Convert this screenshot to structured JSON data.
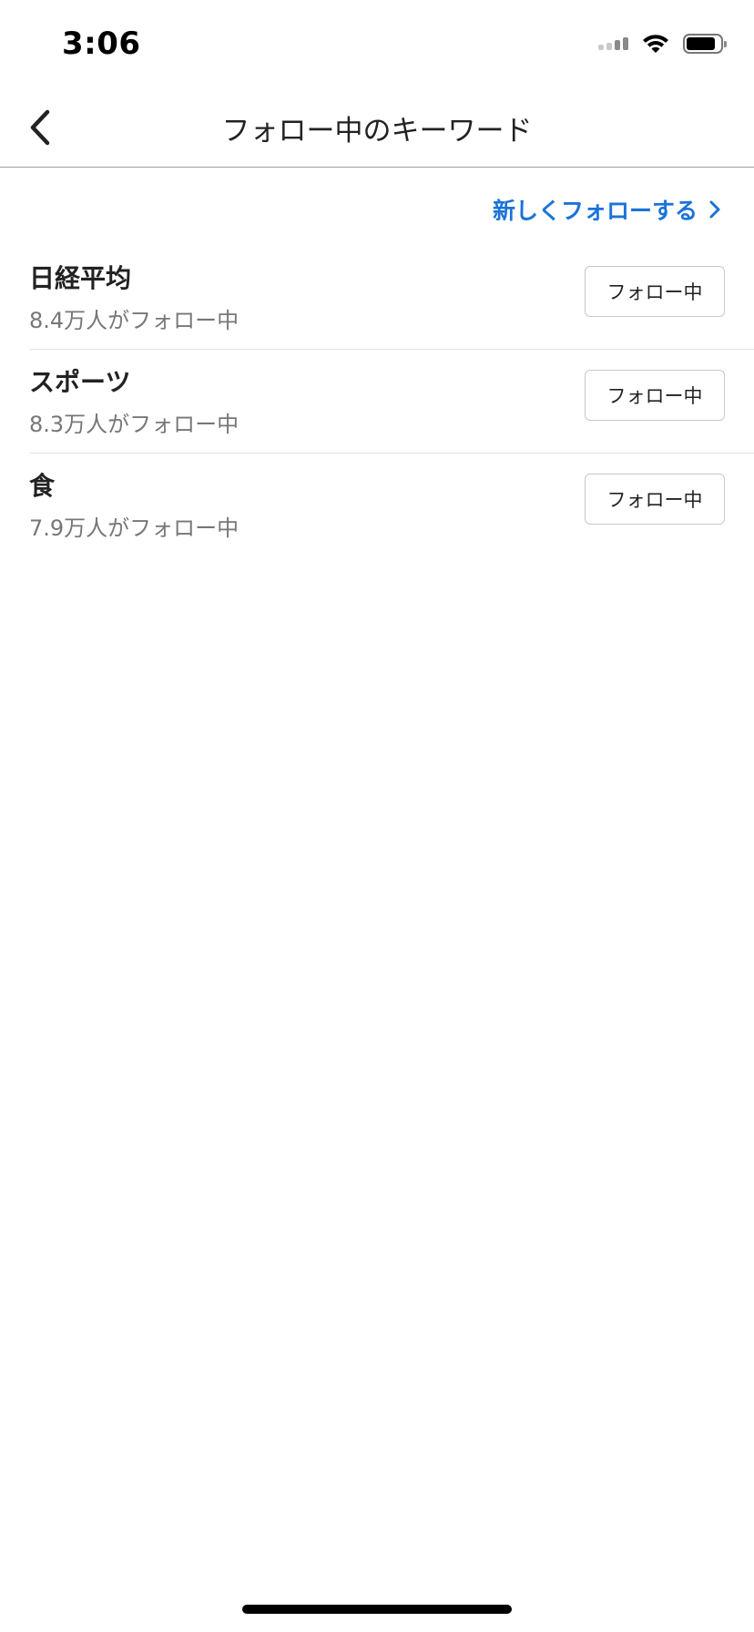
{
  "status_bar": {
    "time": "3:06",
    "battery_level": 0.85
  },
  "header": {
    "title": "フォロー中のキーワード"
  },
  "follow_new_label": "新しくフォローする",
  "keywords": [
    {
      "name": "日経平均",
      "count": "8.4万人がフォロー中",
      "button_label": "フォロー中"
    },
    {
      "name": "スポーツ",
      "count": "8.3万人がフォロー中",
      "button_label": "フォロー中"
    },
    {
      "name": "食",
      "count": "7.9万人がフォロー中",
      "button_label": "フォロー中"
    }
  ],
  "icons": {
    "back": "chevron-left-icon",
    "follow_new": "chevron-right-icon",
    "wifi": "wifi-icon",
    "signal": "cellular-signal-icon",
    "battery": "battery-icon"
  },
  "colors": {
    "accent": "#1a73d8",
    "text_primary": "#222222",
    "text_secondary": "#777777",
    "divider": "#e3e3e3"
  }
}
